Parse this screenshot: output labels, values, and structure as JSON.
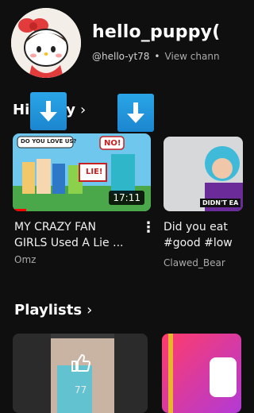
{
  "channel": {
    "name": "hello_puppy(",
    "handle": "@hello-yt78",
    "separator": "•",
    "view_channel": "View chann"
  },
  "sections": {
    "history_title_left": "Hi",
    "history_title_right": "y",
    "playlists_title": "Playlists"
  },
  "videos": [
    {
      "title_line1": "MY CRAZY FAN",
      "title_line2": "GIRLS Used A Lie ...",
      "channel": "Omz",
      "duration": "17:11",
      "thumb_text_1": "DO YOU LOVE US?",
      "thumb_text_2": "NO!",
      "thumb_text_3": "LIE!",
      "progress": 0.1
    },
    {
      "title_line1": "Did you eat",
      "title_line2": "#good #low",
      "channel": "Clawed_Bear",
      "thumb_text": "DIDN'T EA"
    }
  ],
  "playlists": [
    {
      "count": "77"
    }
  ],
  "icons": {
    "chevron": "chevron-right-icon",
    "overlay": "download-arrow-icon",
    "menu": "more-vertical-icon",
    "playlist": "thumbs-up-icon"
  },
  "colors": {
    "background": "#0f0f0f",
    "progress": "#ff0000",
    "overlay_blue": "#1b86cf"
  }
}
